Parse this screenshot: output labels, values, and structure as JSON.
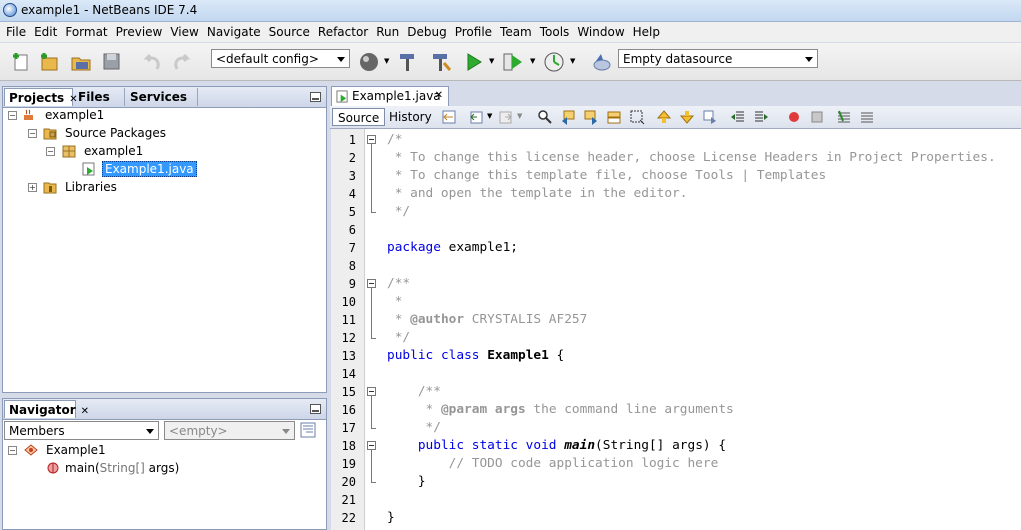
{
  "window": {
    "title": "example1 - NetBeans IDE 7.4"
  },
  "menu": [
    "File",
    "Edit",
    "Format",
    "Preview",
    "View",
    "Navigate",
    "Source",
    "Refactor",
    "Run",
    "Debug",
    "Profile",
    "Team",
    "Tools",
    "Window",
    "Help"
  ],
  "toolbar": {
    "config": "<default config>",
    "datasource": "Empty datasource"
  },
  "projects_panel": {
    "tabs": [
      "Projects",
      "Files",
      "Services"
    ],
    "tree": {
      "project": "example1",
      "source_packages": "Source Packages",
      "package": "example1",
      "file": "Example1.java",
      "libraries": "Libraries"
    }
  },
  "navigator": {
    "title": "Navigator",
    "filter": "Members",
    "empty": "<empty>",
    "class_name": "Example1",
    "method": "main(",
    "method_param": "String[]",
    "method_tail": " args)"
  },
  "editor": {
    "tab_label": "Example1.java",
    "source_label": "Source",
    "history_label": "History",
    "line_numbers": [
      "1",
      "2",
      "3",
      "4",
      "5",
      "6",
      "7",
      "8",
      "9",
      "10",
      "11",
      "12",
      "13",
      "14",
      "15",
      "16",
      "17",
      "18",
      "19",
      "20",
      "21",
      "22"
    ],
    "code": {
      "l1": "/*",
      "l2": " * To change this license header, choose License Headers in Project Properties.",
      "l3": " * To change this template file, choose Tools | Templates",
      "l4": " * and open the template in the editor.",
      "l5": " */",
      "l7_kw": "package",
      "l7_rest": " example1;",
      "l9": "/**",
      "l10": " *",
      "l11_pre": " * ",
      "l11_tag": "@author",
      "l11_rest": " CRYSTALIS AF257",
      "l12": " */",
      "l13_kw1": "public",
      "l13_kw2": "class",
      "l13_name": "Example1",
      "l13_rest": " {",
      "l15": "    /**",
      "l16_pre": "     * ",
      "l16_tag": "@param",
      "l16_param": " args",
      "l16_rest": " the command line arguments",
      "l17": "     */",
      "l18_kw": "    public static void",
      "l18_name": "main",
      "l18_rest": "(String[] args) {",
      "l19": "        // TODO code application logic here",
      "l20": "    }",
      "l22": "}"
    }
  },
  "colors": {
    "keyword": "#0000e6",
    "comment": "#969696",
    "selection": "#3399ff"
  }
}
